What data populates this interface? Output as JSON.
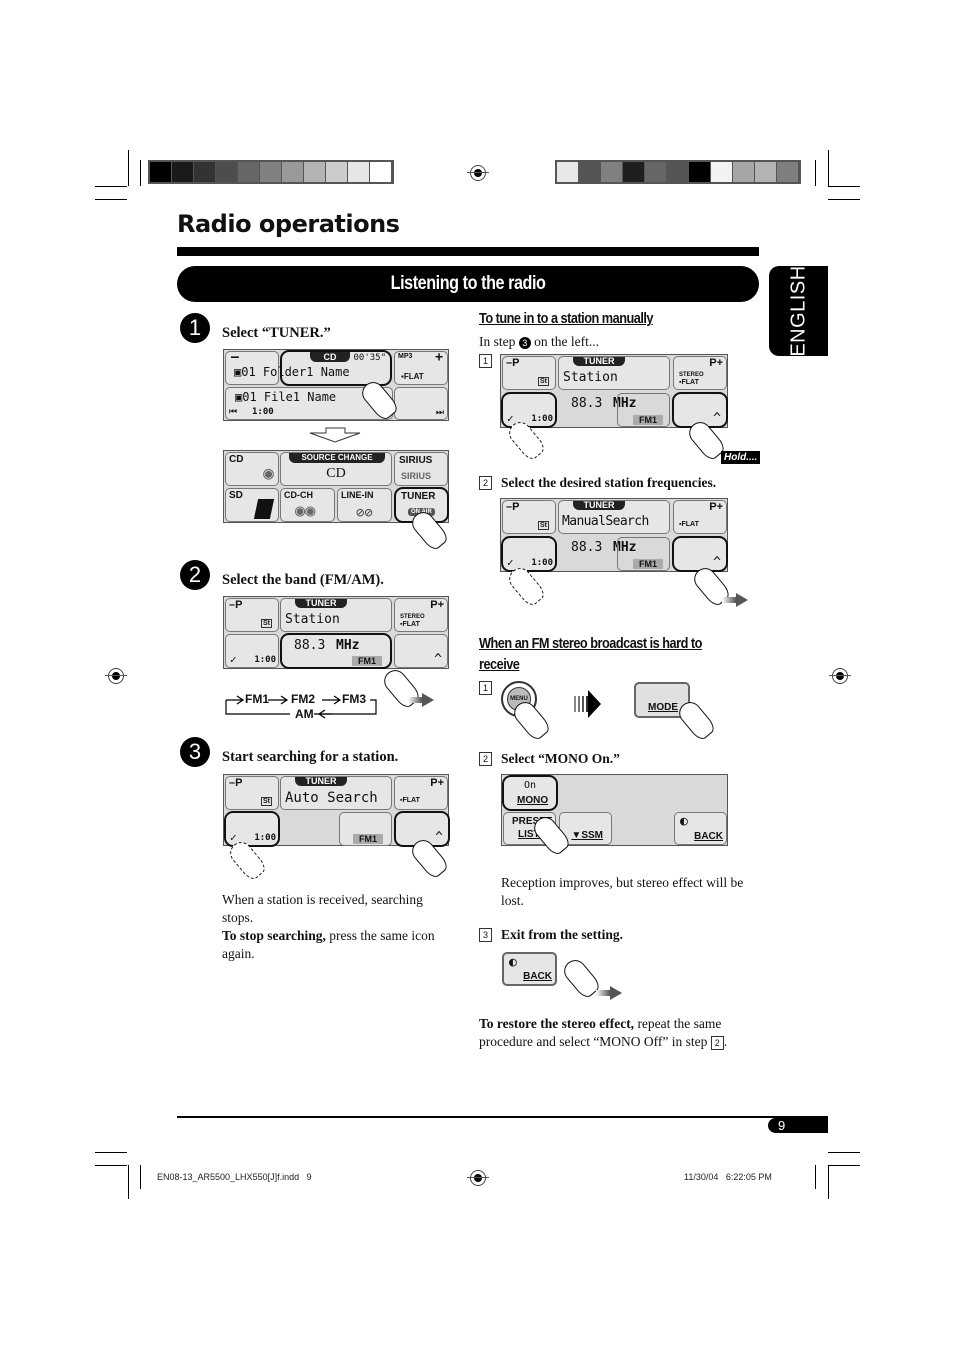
{
  "print_marks": {
    "left_bar_colors": [
      "#000000",
      "#1a1a1a",
      "#333333",
      "#4d4d4d",
      "#666666",
      "#808080",
      "#999999",
      "#b3b3b3",
      "#cccccc",
      "#e6e6e6",
      "#ffffff"
    ],
    "right_bar_colors": [
      "#e8e8e8",
      "#555555",
      "#808080",
      "#1f1f1f",
      "#666666",
      "#555555",
      "#000000",
      "#f2f2f2",
      "#a6a6a6",
      "#b3b3b3",
      "#7f7f7f"
    ]
  },
  "header": {
    "title": "Radio operations",
    "section_title": "Listening to the radio",
    "language_tab": "ENGLISH"
  },
  "left_column": {
    "step1": {
      "number": "1",
      "instruction": "Select “TUNER.”",
      "screen_cd": {
        "source_tab": "CD",
        "time": "00'35\"",
        "format": "MP3",
        "folder": "01 Folder1 Name",
        "file": "01 File1 Name",
        "elapsed": "1:00",
        "eq": "FLAT",
        "minus": "–",
        "plus": "+"
      },
      "screen_source": {
        "header": "SOURCE CHANGE",
        "current": "CD",
        "sources": [
          "CD",
          "SIRIUS",
          "SD",
          "CD-CH",
          "LINE-IN",
          "TUNER"
        ],
        "sirius_logo": "SIRIUS",
        "on_air": "ON AIR"
      }
    },
    "step2": {
      "number": "2",
      "instruction": "Select the band (FM/AM).",
      "screen": {
        "tab": "TUNER",
        "station": "Station",
        "frequency": "88.3",
        "unit": "MHz",
        "band": "FM1",
        "elapsed": "1:00",
        "st": "St",
        "stereo": "STEREO",
        "eq": "FLAT",
        "minus_p": "–P",
        "plus_p": "P+"
      },
      "band_cycle": [
        "FM1",
        "FM2",
        "FM3",
        "AM"
      ]
    },
    "step3": {
      "number": "3",
      "instruction": "Start searching for a station.",
      "screen": {
        "tab": "TUNER",
        "station": "Auto Search",
        "band": "FM1",
        "elapsed": "1:00",
        "st": "St",
        "eq": "FLAT",
        "minus_p": "–P",
        "plus_p": "P+"
      },
      "note1": "When a station is received, searching stops.",
      "note2_bold": "To stop searching,",
      "note2_rest": " press the same icon again."
    }
  },
  "right_column": {
    "manual": {
      "heading": "To tune in to a station manually",
      "intro_pre": "In step ",
      "intro_step": "3",
      "intro_post": " on the left...",
      "sub1": {
        "num": "1",
        "screen": {
          "tab": "TUNER",
          "station": "Station",
          "frequency": "88.3",
          "unit": "MHz",
          "band": "FM1",
          "elapsed": "1:00",
          "st": "St",
          "stereo": "STEREO",
          "eq": "FLAT",
          "minus_p": "–P",
          "plus_p": "P+"
        },
        "hold_label": "Hold...."
      },
      "sub2": {
        "num": "2",
        "instruction": "Select the desired station frequencies.",
        "screen": {
          "tab": "TUNER",
          "station": "ManualSearch",
          "frequency": "88.3",
          "unit": "MHz",
          "band": "FM1",
          "elapsed": "1:00",
          "st": "St",
          "eq": "FLAT",
          "minus_p": "–P",
          "plus_p": "P+"
        }
      }
    },
    "mono": {
      "heading_line1": "When an FM stereo broadcast is hard to",
      "heading_line2": "receive",
      "sub1": {
        "num": "1",
        "menu_label": "MENU",
        "mode_label": "MODE"
      },
      "sub2": {
        "num": "2",
        "instruction": "Select “MONO On.”",
        "screen": {
          "mono_state": "On",
          "mono_label": "MONO",
          "preset_top": "PRESET",
          "preset_bottom": "LIST",
          "ssm": "SSM",
          "back": "BACK"
        },
        "note": "Reception improves, but stereo effect will be lost."
      },
      "sub3": {
        "num": "3",
        "instruction": "Exit from the setting.",
        "back": "BACK"
      },
      "restore_bold": "To restore the stereo effect,",
      "restore_rest": " repeat the same procedure and select “MONO Off” in step ",
      "restore_step": "2",
      "restore_end": "."
    }
  },
  "footer": {
    "page_number": "9",
    "file_name": "EN08-13_AR5500_LHX550[J]f.indd   9",
    "timestamp": "11/30/04   6:22:05 PM"
  }
}
